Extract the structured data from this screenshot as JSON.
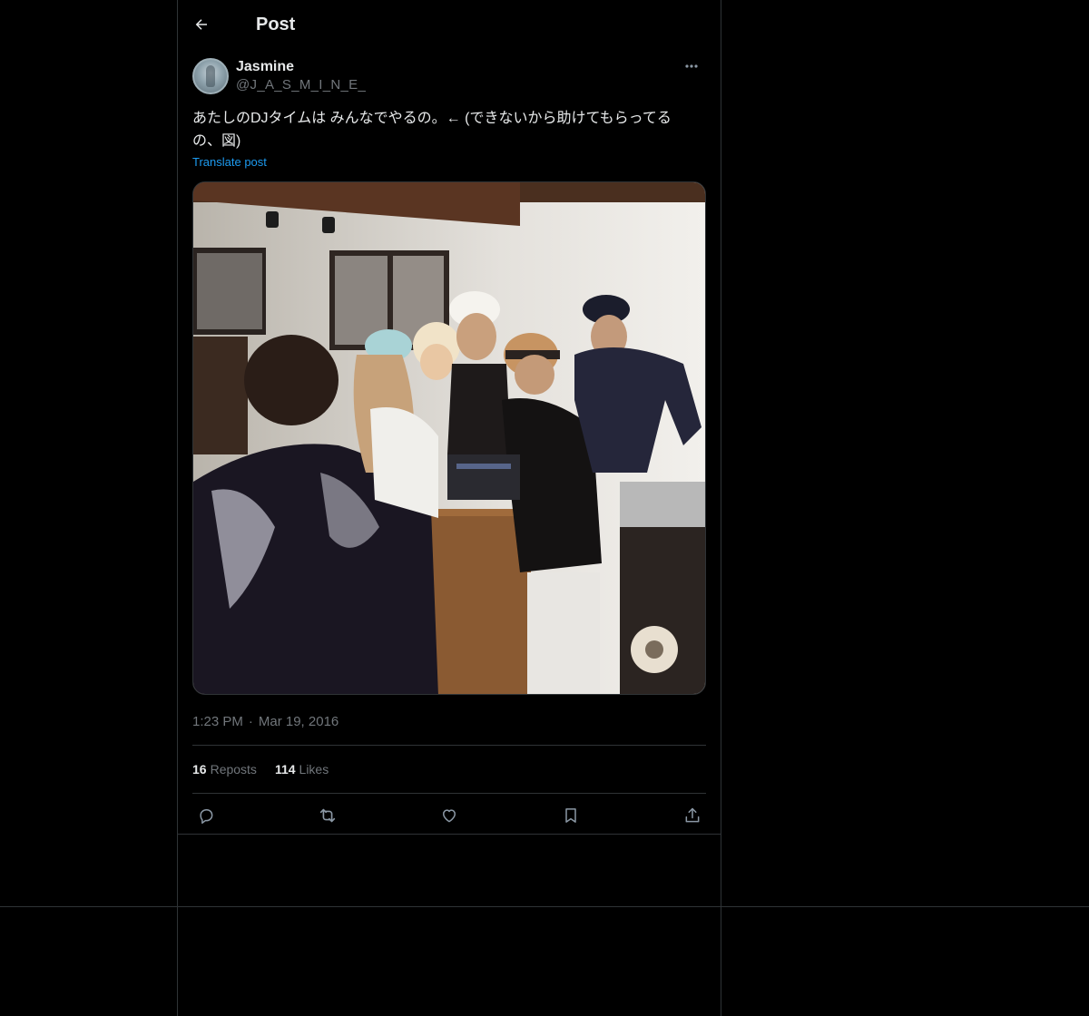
{
  "header": {
    "title": "Post"
  },
  "post": {
    "author": {
      "name": "Jasmine",
      "handle": "@J_A_S_M_I_N_E_"
    },
    "text_line1": "あたしのDJタイムは みんなでやるの。← (できないから助けてもらってる",
    "text_line2": "の、図)",
    "translate_label": "Translate post",
    "time": "1:23 PM",
    "separator": "·",
    "date": "Mar 19, 2016",
    "reposts_count": "16",
    "reposts_label": "Reposts",
    "likes_count": "114",
    "likes_label": "Likes"
  },
  "icons": {
    "back": "arrow-left-icon",
    "more": "more-horizontal-icon",
    "reply": "reply-icon",
    "repost": "repost-icon",
    "like": "heart-icon",
    "bookmark": "bookmark-icon",
    "share": "share-icon"
  },
  "colors": {
    "background": "#000000",
    "text": "#e7e9ea",
    "muted": "#71767b",
    "link": "#1d9bf0",
    "border": "#2f3336"
  }
}
